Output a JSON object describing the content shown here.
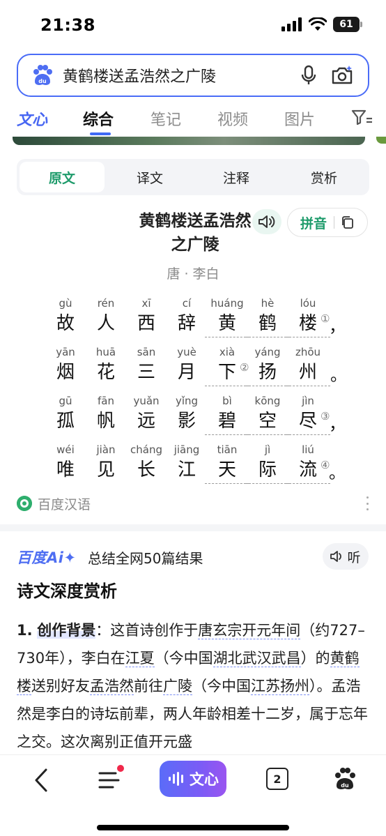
{
  "status_bar": {
    "time": "21:38",
    "battery": "61"
  },
  "search": {
    "query": "黄鹤楼送孟浩然之广陵",
    "logo_icon": "baidu-paw-icon"
  },
  "top_tabs": [
    {
      "label": "文心"
    },
    {
      "label": "综合",
      "active": true
    },
    {
      "label": "笔记"
    },
    {
      "label": "视频"
    },
    {
      "label": "图片"
    }
  ],
  "segment_tabs": [
    {
      "label": "原文",
      "active": true
    },
    {
      "label": "译文"
    },
    {
      "label": "注释"
    },
    {
      "label": "赏析"
    }
  ],
  "poem": {
    "title": "黄鹤楼送孟浩然之广陵",
    "author": "唐 · 李白",
    "pinyin_button": "拼音",
    "lines": [
      {
        "chars": [
          {
            "py": "gù",
            "hz": "故"
          },
          {
            "py": "rén",
            "hz": "人"
          },
          {
            "py": "xī",
            "hz": "西"
          },
          {
            "py": "cí",
            "hz": "辞"
          },
          {
            "py": "huáng",
            "hz": "黄"
          },
          {
            "py": "hè",
            "hz": "鹤"
          },
          {
            "py": "lóu",
            "hz": "楼"
          }
        ],
        "note": "①",
        "punct": "，"
      },
      {
        "chars": [
          {
            "py": "yān",
            "hz": "烟"
          },
          {
            "py": "huā",
            "hz": "花"
          },
          {
            "py": "sān",
            "hz": "三"
          },
          {
            "py": "yuè",
            "hz": "月"
          },
          {
            "py": "xià",
            "hz": "下"
          },
          {
            "py": "yáng",
            "hz": "扬"
          },
          {
            "py": "zhōu",
            "hz": "州"
          }
        ],
        "note": "②",
        "punct": "。"
      },
      {
        "chars": [
          {
            "py": "gū",
            "hz": "孤"
          },
          {
            "py": "fān",
            "hz": "帆"
          },
          {
            "py": "yuǎn",
            "hz": "远"
          },
          {
            "py": "yǐng",
            "hz": "影"
          },
          {
            "py": "bì",
            "hz": "碧"
          },
          {
            "py": "kōng",
            "hz": "空"
          },
          {
            "py": "jìn",
            "hz": "尽"
          }
        ],
        "note": "③",
        "punct": "，"
      },
      {
        "chars": [
          {
            "py": "wéi",
            "hz": "唯"
          },
          {
            "py": "jiàn",
            "hz": "见"
          },
          {
            "py": "cháng",
            "hz": "长"
          },
          {
            "py": "jiāng",
            "hz": "江"
          },
          {
            "py": "tiān",
            "hz": "天"
          },
          {
            "py": "jì",
            "hz": "际"
          },
          {
            "py": "liú",
            "hz": "流"
          }
        ],
        "note": "④",
        "punct": "。"
      }
    ]
  },
  "source": {
    "label": "百度汉语"
  },
  "ai": {
    "logo": "百度Ai✦",
    "summary": "总结全网50篇结果",
    "listen_label": "听",
    "heading": "诗文深度赏析",
    "paragraph": {
      "num": "1.",
      "lead": "创作背景",
      "colon": "：这首诗创作于",
      "l1": "唐玄宗开元年间",
      "t1": "（约727–730年），李白在",
      "l2": "江夏",
      "t2": "（今中国",
      "l3": "湖北武汉武昌",
      "t3": "）的",
      "l4": "黄鹤楼",
      "t4": "送别好友",
      "l5": "孟浩然",
      "t5": "前往",
      "l6": "广陵",
      "t6": "（今中国",
      "l7": "江苏扬州",
      "t7": "）。孟浩然是李白的诗坛前辈，两人年龄相差十二岁，属于忘年之交。这次离别正值开元盛"
    }
  },
  "bottom_nav": {
    "wenxin_label": "文心",
    "tab_count": "2"
  }
}
